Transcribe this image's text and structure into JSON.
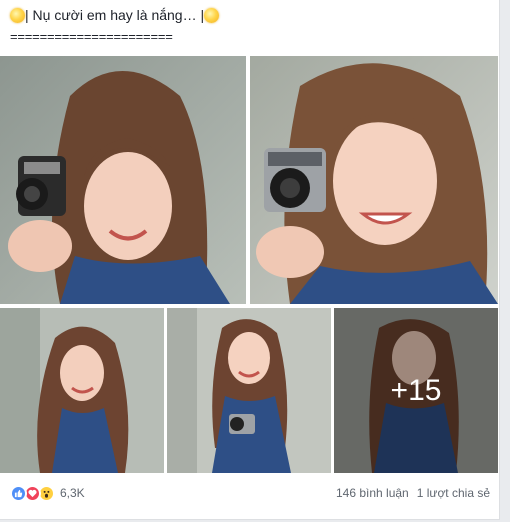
{
  "post": {
    "caption_text": "| Nụ cười em hay là nắng… |",
    "separator": "======================",
    "more_photos": "+15"
  },
  "footer": {
    "reaction_count": "6,3K",
    "comments": "146 bình luận",
    "shares": "1 lượt chia sẻ"
  },
  "icons": {
    "caption_left": "sun-emoji",
    "caption_right": "sun-emoji",
    "reactions": [
      "like-icon",
      "love-icon",
      "wow-icon"
    ]
  },
  "colors": {
    "like": "#4f8ff7",
    "love": "#f0435a",
    "wow": "#ffd040",
    "dress": "#2e4f86"
  }
}
